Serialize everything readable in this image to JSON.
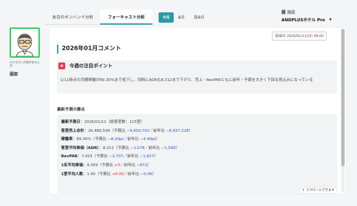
{
  "sidebar": {
    "mascot_caption": "ロクるさいが来がある上司",
    "mascot_name": "服部"
  },
  "tabs": {
    "items": [
      "本日のオンハンド分析",
      "フォーキャスト分析"
    ],
    "active": "フォーキャスト分析"
  },
  "period": {
    "options": [
      "今月",
      "来月",
      "再来月"
    ],
    "selected": "今月"
  },
  "store": {
    "label": "施設",
    "value": "ANDPLUSホテル Pro"
  },
  "fetched": {
    "prefix": "取得日:",
    "date": "2026/01/11",
    "weekday": "日",
    "time": "08:00"
  },
  "comment": {
    "title": "2026年01月コメント",
    "focus_title": "今週の注目ポイント",
    "focus_text": "1/11時点の月間稼働が89.30%まで低下し、同時にADRも8,312まで下がり、売上・RevPARともに前年・予算を大きく下回る見込みになっている",
    "section_title": "最新予測の要点"
  },
  "points": {
    "forecast_date": {
      "label": "最新予測日",
      "value": "2026/01/11（総客室数：115室）"
    },
    "revenue": {
      "label": "客室売上合計",
      "value": "26,466,599",
      "budget_prefix": "（予算比 ",
      "budget": "−9,650,702",
      "ly_prefix": "／前年比 ",
      "ly": "−6,937,228",
      "suffix": "）"
    },
    "occupancy": {
      "label": "稼働率",
      "value": "89.30%",
      "budget_prefix": "（予算比 ",
      "budget": "−8.20pt",
      "ly_prefix": "／前年比 ",
      "ly": "−4.40pt",
      "suffix": "）"
    },
    "adr": {
      "label": "客室平均単価（ADR）",
      "value": "8,312",
      "budget_prefix": "（予算比 ",
      "budget": "−2,078",
      "ly_prefix": "／前年比 ",
      "ly": "−1,560",
      "suffix": "）"
    },
    "revpar": {
      "label": "RevPAR",
      "value": "7,423",
      "budget_prefix": "（予算比 ",
      "budget": "−2,707",
      "ly_prefix": "／前年比 ",
      "ly": "−1,827",
      "suffix": "）"
    },
    "per_person": {
      "label": "1名平均単価",
      "value": "4,359",
      "budget_prefix": "（予算比 ",
      "budget": "+0",
      "ly_prefix": "／前年比 ",
      "ly": "−672",
      "suffix": "）"
    },
    "guests_per_room": {
      "label": "1室平均人数",
      "value": "1.90",
      "budget_prefix": "（予算比 ",
      "budget": "+0.00",
      "ly_prefix": "／前年比 ",
      "ly": "−0.06",
      "suffix": "）"
    }
  },
  "scroll_hint": "スクロールできます",
  "colors": {
    "accent": "#2a9aa5",
    "mascot_bg": "#2ecc55",
    "negative": "#2255cc",
    "positive": "#dd2222",
    "badge": "#e8374a"
  }
}
